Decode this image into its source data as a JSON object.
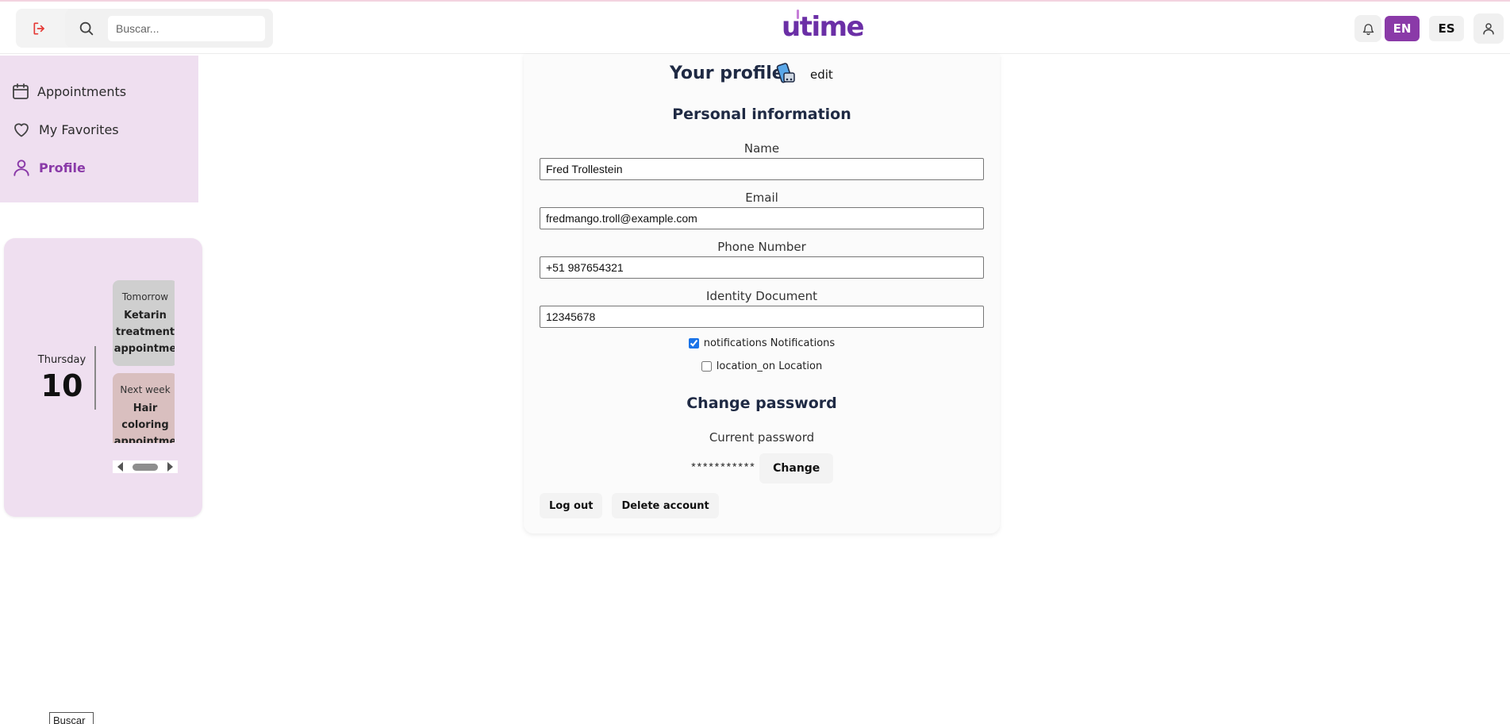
{
  "header": {
    "search_placeholder": "Buscar...",
    "logo_text": "utime",
    "lang_en": "EN",
    "lang_es": "ES"
  },
  "sidebar": {
    "items": [
      {
        "label": "Appointments",
        "icon": "calendar-icon"
      },
      {
        "label": "My Favorites",
        "icon": "heart-icon"
      },
      {
        "label": "Profile",
        "icon": "user-icon",
        "active": true
      }
    ]
  },
  "upcoming": {
    "day_name": "Thursday",
    "day_number": "10",
    "appointments": [
      {
        "when": "Tomorrow",
        "what": "Ketarin\ntreatment\nappointme"
      },
      {
        "when": "Next week",
        "what": "Hair\ncoloring\nappointme"
      }
    ]
  },
  "profile": {
    "title": "Your profile",
    "edit_label": "edit",
    "personal_info_title": "Personal information",
    "fields": [
      {
        "label": "Name",
        "value": "Fred Trollestein"
      },
      {
        "label": "Email",
        "value": "fredmango.troll@example.com"
      },
      {
        "label": "Phone Number",
        "value": "+51 987654321"
      },
      {
        "label": "Identity Document",
        "value": "12345678"
      }
    ],
    "notifications_label": "notifications Notifications",
    "notifications_checked": true,
    "location_label": "location_on Location",
    "location_checked": false,
    "change_password_title": "Change password",
    "current_password_label": "Current password",
    "password_mask": "***********",
    "change_button": "Change",
    "logout_button": "Log out",
    "delete_button": "Delete account"
  },
  "floating_search_text": "Buscar",
  "colors": {
    "brand": "#6b2fa6",
    "accent": "#8a3aa8",
    "sidebar_bg": "#efdff0",
    "logout_red": "#e53935"
  }
}
